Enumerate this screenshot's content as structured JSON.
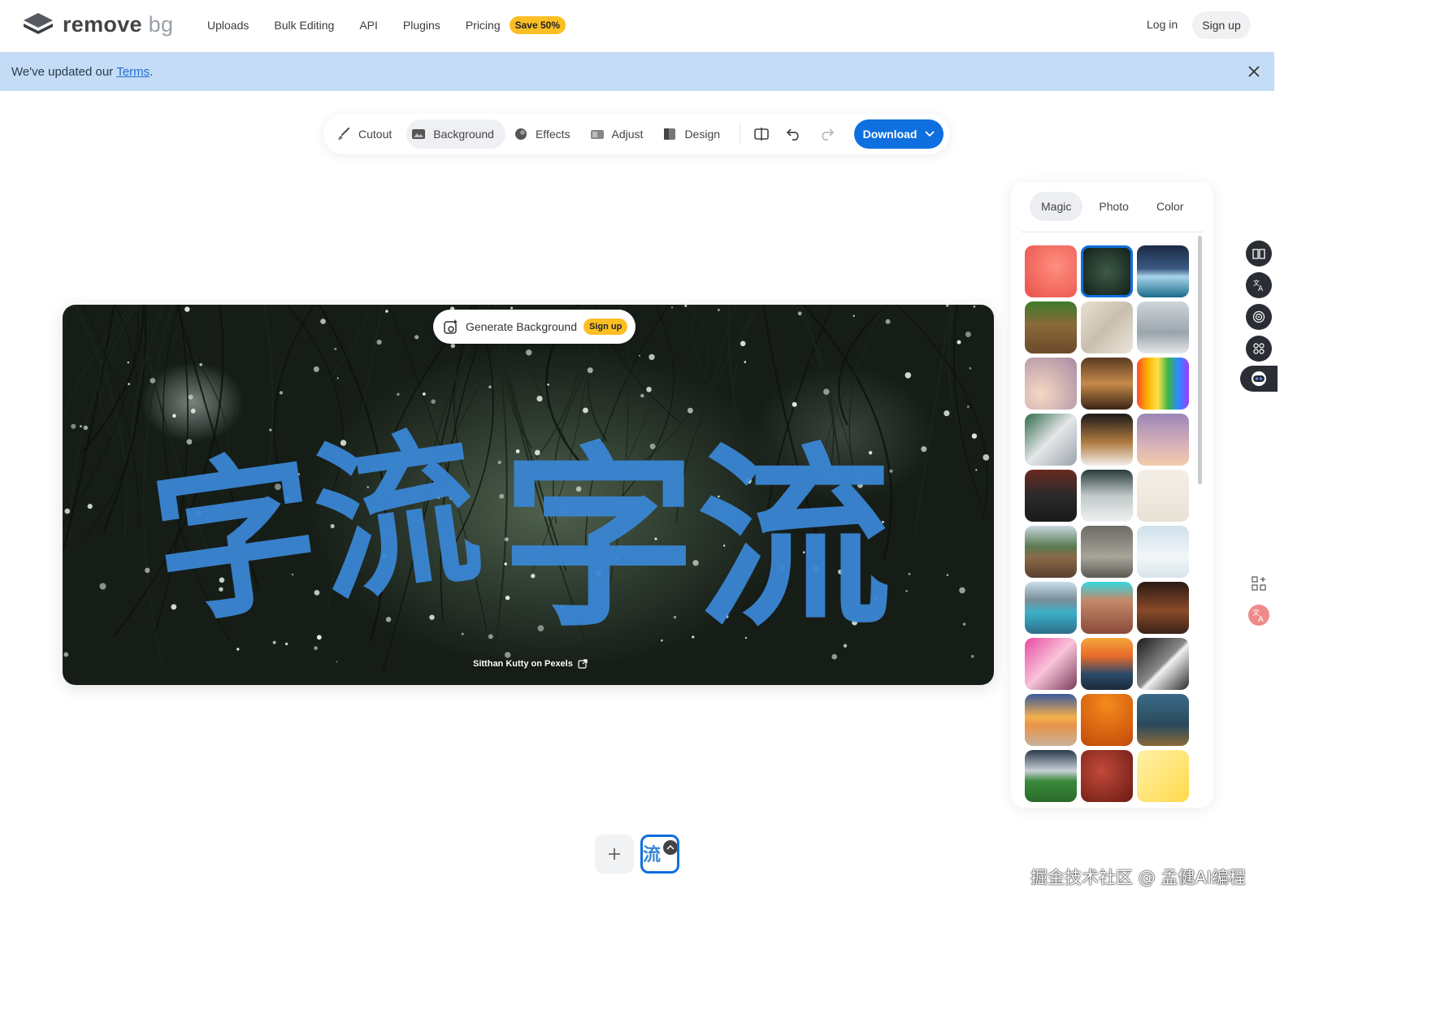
{
  "brand": {
    "name_main": "remove",
    "name_suffix": "bg"
  },
  "nav": {
    "links": [
      "Uploads",
      "Bulk Editing",
      "API",
      "Plugins",
      "Pricing"
    ],
    "save_badge": "Save 50%",
    "login": "Log in",
    "signup": "Sign up"
  },
  "banner": {
    "prefix": "We've updated our ",
    "link": "Terms",
    "suffix": "."
  },
  "toolbar": {
    "tools": [
      {
        "label": "Cutout",
        "icon": "brush-icon",
        "active": false
      },
      {
        "label": "Background",
        "icon": "image-icon",
        "active": true
      },
      {
        "label": "Effects",
        "icon": "effects-icon",
        "active": false
      },
      {
        "label": "Adjust",
        "icon": "adjust-icon",
        "active": false
      },
      {
        "label": "Design",
        "icon": "design-icon",
        "active": false
      }
    ],
    "download_label": "Download"
  },
  "canvas": {
    "generate_label": "Generate Background",
    "generate_badge": "Sign up",
    "credit": "Sitthan Kutty on Pexels",
    "overlay_text": [
      "字流",
      "字流"
    ]
  },
  "panel": {
    "tabs": [
      "Magic",
      "Photo",
      "Color"
    ],
    "active_tab": "Magic",
    "selected_index": 1,
    "thumbnails": [
      "coral-gradient",
      "rain-droplets-pine",
      "iceberg-sea",
      "wooden-cabin",
      "beige-fabric",
      "modern-interior",
      "lavender-peach-gradient",
      "coffee-croissant",
      "rainbow-stripes",
      "glass-on-marble",
      "leather-shoes",
      "purple-peach-sky",
      "kettlebells",
      "white-corridor",
      "plant-in-vase",
      "wooden-pier",
      "concrete-plant-room",
      "snowy-interior",
      "mountain-lake",
      "desert-dune",
      "rustic-table",
      "pink-interior",
      "ocean-sunset-rocks",
      "train-station",
      "beach-sunset",
      "orange-gradient",
      "teal-workspace",
      "soccer-stadium",
      "red-texture",
      "yellow-gradient"
    ]
  },
  "bottom": {
    "thumb_text": "流字"
  },
  "watermark": "掘金技术社区 @ 孟健AI编程"
}
